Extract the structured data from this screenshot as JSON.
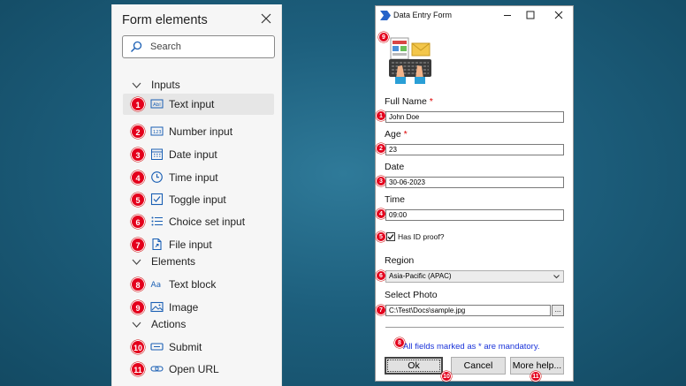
{
  "left_panel": {
    "title": "Form elements",
    "search_placeholder": "Search",
    "sections": {
      "inputs": "Inputs",
      "elements": "Elements",
      "actions": "Actions"
    },
    "items": [
      {
        "num": "1",
        "label": "Text input",
        "icon": "text-input-icon"
      },
      {
        "num": "2",
        "label": "Number input",
        "icon": "number-input-icon"
      },
      {
        "num": "3",
        "label": "Date input",
        "icon": "calendar-icon"
      },
      {
        "num": "4",
        "label": "Time input",
        "icon": "clock-icon"
      },
      {
        "num": "5",
        "label": "Toggle input",
        "icon": "checkbox-icon"
      },
      {
        "num": "6",
        "label": "Choice set input",
        "icon": "list-icon"
      },
      {
        "num": "7",
        "label": "File input",
        "icon": "file-icon"
      },
      {
        "num": "8",
        "label": "Text block",
        "icon": "text-block-icon"
      },
      {
        "num": "9",
        "label": "Image",
        "icon": "image-icon"
      },
      {
        "num": "10",
        "label": "Submit",
        "icon": "submit-icon"
      },
      {
        "num": "11",
        "label": "Open URL",
        "icon": "link-icon"
      }
    ]
  },
  "window": {
    "title": "Data Entry Form",
    "image_badge": "9",
    "fields": {
      "full_name_label": "Full Name",
      "full_name_value": "John Doe",
      "age_label": "Age",
      "age_value": "23",
      "date_label": "Date",
      "date_value": "30-06-2023",
      "time_label": "Time",
      "time_value": "09:00",
      "id_proof_label": "Has ID proof?",
      "id_proof_checked": true,
      "region_label": "Region",
      "region_value": "Asia-Pacific (APAC)",
      "photo_label": "Select Photo",
      "photo_value": "C:\\Test\\Docs\\sample.jpg",
      "browse_label": "...",
      "required_mark": "*"
    },
    "note": "All fields marked as * are mandatory.",
    "buttons": {
      "ok": "Ok",
      "cancel": "Cancel",
      "more_help": "More help..."
    },
    "badges": {
      "full_name": "1",
      "age": "2",
      "date": "3",
      "time": "4",
      "toggle": "5",
      "region": "6",
      "photo": "7",
      "note": "8",
      "ok": "10",
      "more_help": "11"
    }
  }
}
